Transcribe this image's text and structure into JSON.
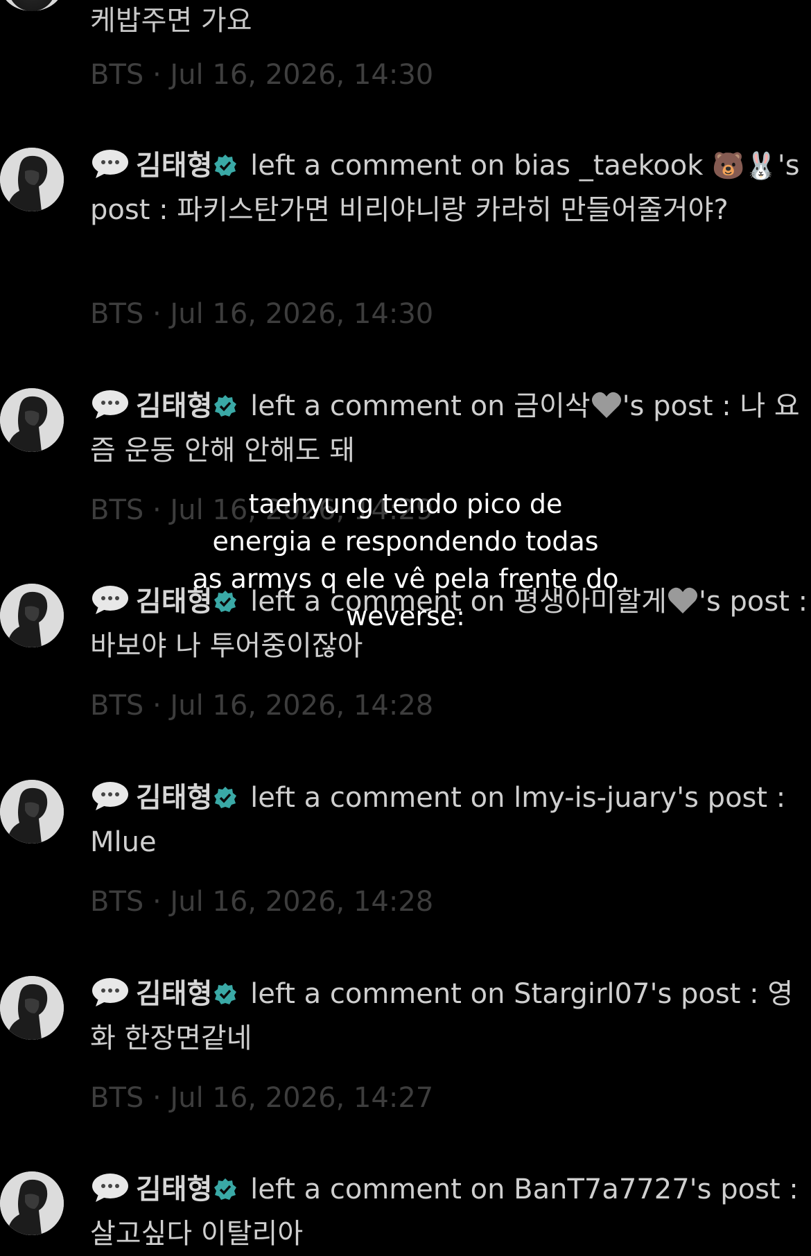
{
  "top": {
    "text": "케밥주면 가요",
    "meta": "BTS · Jul 16, 2026, 14:30"
  },
  "notifications": [
    {
      "user": "김태형",
      "action": "left a comment on",
      "post_owner": "bias _taekook",
      "owner_suffix": "🐻🐰",
      "post_label": "'s post :",
      "comment": "파키스탄가면 비리야니랑 카라히 만들어줄거야?",
      "community": "BTS",
      "timestamp": "Jul 16, 2026, 14:30"
    },
    {
      "user": "김태형",
      "action": "left a comment on",
      "post_owner": "금이삭",
      "owner_suffix": "🩶",
      "post_label": "'s post :",
      "comment": "나 요즘 운동 안해 안해도 돼",
      "community": "BTS",
      "timestamp": "Jul 16, 2026, 14:29"
    },
    {
      "user": "김태형",
      "action": "left a comment on",
      "post_owner": "평생아미할게",
      "owner_suffix": "🩶",
      "post_label": "'s post :",
      "comment": "바보야 나 투어중이잖아",
      "community": "BTS",
      "timestamp": "Jul 16, 2026, 14:28"
    },
    {
      "user": "김태형",
      "action": "left a comment on",
      "post_owner": "lmy-is-juary",
      "owner_suffix": "",
      "post_label": "'s post :",
      "comment": "Mlue",
      "community": "BTS",
      "timestamp": "Jul 16, 2026, 14:28"
    },
    {
      "user": "김태형",
      "action": "left a comment on",
      "post_owner": "Stargirl07",
      "owner_suffix": "",
      "post_label": "'s post :",
      "comment": "영화 한장면같네",
      "community": "BTS",
      "timestamp": "Jul 16, 2026, 14:27"
    },
    {
      "user": "김태형",
      "action": "left a comment on",
      "post_owner": "BanT7a7727",
      "owner_suffix": "",
      "post_label": "'s post :",
      "comment": "살고싶다 이탈리아",
      "community": "BTS",
      "timestamp": ""
    }
  ],
  "caption": {
    "line1": "taehyung tendo pico de",
    "line2": "energia e respondendo todas",
    "line3": "as armys q ele vê pela frente do",
    "line4": "weverse:"
  },
  "icons": {
    "bubble": "speech-bubble-icon",
    "verified": "verified-badge-icon",
    "heart": "grey-heart-icon"
  },
  "colors": {
    "background": "#000000",
    "verified": "#3aa9a6",
    "meta": "#3d3d3d",
    "text": "#cfcfcf"
  }
}
